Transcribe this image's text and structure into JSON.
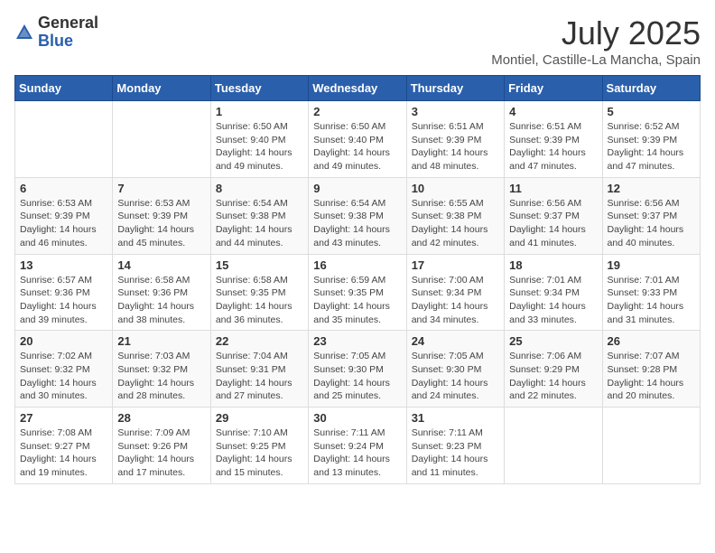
{
  "header": {
    "logo_general": "General",
    "logo_blue": "Blue",
    "month_title": "July 2025",
    "location": "Montiel, Castille-La Mancha, Spain"
  },
  "days_of_week": [
    "Sunday",
    "Monday",
    "Tuesday",
    "Wednesday",
    "Thursday",
    "Friday",
    "Saturday"
  ],
  "weeks": [
    [
      {
        "day": "",
        "info": ""
      },
      {
        "day": "",
        "info": ""
      },
      {
        "day": "1",
        "info": "Sunrise: 6:50 AM\nSunset: 9:40 PM\nDaylight: 14 hours and 49 minutes."
      },
      {
        "day": "2",
        "info": "Sunrise: 6:50 AM\nSunset: 9:40 PM\nDaylight: 14 hours and 49 minutes."
      },
      {
        "day": "3",
        "info": "Sunrise: 6:51 AM\nSunset: 9:39 PM\nDaylight: 14 hours and 48 minutes."
      },
      {
        "day": "4",
        "info": "Sunrise: 6:51 AM\nSunset: 9:39 PM\nDaylight: 14 hours and 47 minutes."
      },
      {
        "day": "5",
        "info": "Sunrise: 6:52 AM\nSunset: 9:39 PM\nDaylight: 14 hours and 47 minutes."
      }
    ],
    [
      {
        "day": "6",
        "info": "Sunrise: 6:53 AM\nSunset: 9:39 PM\nDaylight: 14 hours and 46 minutes."
      },
      {
        "day": "7",
        "info": "Sunrise: 6:53 AM\nSunset: 9:39 PM\nDaylight: 14 hours and 45 minutes."
      },
      {
        "day": "8",
        "info": "Sunrise: 6:54 AM\nSunset: 9:38 PM\nDaylight: 14 hours and 44 minutes."
      },
      {
        "day": "9",
        "info": "Sunrise: 6:54 AM\nSunset: 9:38 PM\nDaylight: 14 hours and 43 minutes."
      },
      {
        "day": "10",
        "info": "Sunrise: 6:55 AM\nSunset: 9:38 PM\nDaylight: 14 hours and 42 minutes."
      },
      {
        "day": "11",
        "info": "Sunrise: 6:56 AM\nSunset: 9:37 PM\nDaylight: 14 hours and 41 minutes."
      },
      {
        "day": "12",
        "info": "Sunrise: 6:56 AM\nSunset: 9:37 PM\nDaylight: 14 hours and 40 minutes."
      }
    ],
    [
      {
        "day": "13",
        "info": "Sunrise: 6:57 AM\nSunset: 9:36 PM\nDaylight: 14 hours and 39 minutes."
      },
      {
        "day": "14",
        "info": "Sunrise: 6:58 AM\nSunset: 9:36 PM\nDaylight: 14 hours and 38 minutes."
      },
      {
        "day": "15",
        "info": "Sunrise: 6:58 AM\nSunset: 9:35 PM\nDaylight: 14 hours and 36 minutes."
      },
      {
        "day": "16",
        "info": "Sunrise: 6:59 AM\nSunset: 9:35 PM\nDaylight: 14 hours and 35 minutes."
      },
      {
        "day": "17",
        "info": "Sunrise: 7:00 AM\nSunset: 9:34 PM\nDaylight: 14 hours and 34 minutes."
      },
      {
        "day": "18",
        "info": "Sunrise: 7:01 AM\nSunset: 9:34 PM\nDaylight: 14 hours and 33 minutes."
      },
      {
        "day": "19",
        "info": "Sunrise: 7:01 AM\nSunset: 9:33 PM\nDaylight: 14 hours and 31 minutes."
      }
    ],
    [
      {
        "day": "20",
        "info": "Sunrise: 7:02 AM\nSunset: 9:32 PM\nDaylight: 14 hours and 30 minutes."
      },
      {
        "day": "21",
        "info": "Sunrise: 7:03 AM\nSunset: 9:32 PM\nDaylight: 14 hours and 28 minutes."
      },
      {
        "day": "22",
        "info": "Sunrise: 7:04 AM\nSunset: 9:31 PM\nDaylight: 14 hours and 27 minutes."
      },
      {
        "day": "23",
        "info": "Sunrise: 7:05 AM\nSunset: 9:30 PM\nDaylight: 14 hours and 25 minutes."
      },
      {
        "day": "24",
        "info": "Sunrise: 7:05 AM\nSunset: 9:30 PM\nDaylight: 14 hours and 24 minutes."
      },
      {
        "day": "25",
        "info": "Sunrise: 7:06 AM\nSunset: 9:29 PM\nDaylight: 14 hours and 22 minutes."
      },
      {
        "day": "26",
        "info": "Sunrise: 7:07 AM\nSunset: 9:28 PM\nDaylight: 14 hours and 20 minutes."
      }
    ],
    [
      {
        "day": "27",
        "info": "Sunrise: 7:08 AM\nSunset: 9:27 PM\nDaylight: 14 hours and 19 minutes."
      },
      {
        "day": "28",
        "info": "Sunrise: 7:09 AM\nSunset: 9:26 PM\nDaylight: 14 hours and 17 minutes."
      },
      {
        "day": "29",
        "info": "Sunrise: 7:10 AM\nSunset: 9:25 PM\nDaylight: 14 hours and 15 minutes."
      },
      {
        "day": "30",
        "info": "Sunrise: 7:11 AM\nSunset: 9:24 PM\nDaylight: 14 hours and 13 minutes."
      },
      {
        "day": "31",
        "info": "Sunrise: 7:11 AM\nSunset: 9:23 PM\nDaylight: 14 hours and 11 minutes."
      },
      {
        "day": "",
        "info": ""
      },
      {
        "day": "",
        "info": ""
      }
    ]
  ]
}
